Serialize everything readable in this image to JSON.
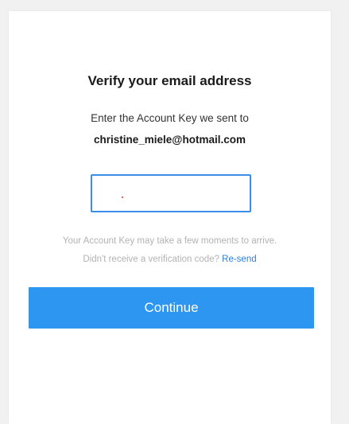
{
  "verify": {
    "title": "Verify your email address",
    "instructions": "Enter the Account Key we sent to",
    "email": "christine_miele@hotmail.com",
    "account_key_value": "",
    "note_line1": "Your Account Key may take a few moments to arrive.",
    "note_line2_prefix": "Didn't receive a verification code?",
    "resend_label": "Re-send",
    "continue_label": "Continue"
  },
  "colors": {
    "page_background": "#f1f1f1",
    "card_background": "#ffffff",
    "accent_blue": "#2d96f0",
    "input_border": "#3b8ee8",
    "link_blue": "#2f7fd9",
    "muted_text": "#b3b3b3"
  }
}
